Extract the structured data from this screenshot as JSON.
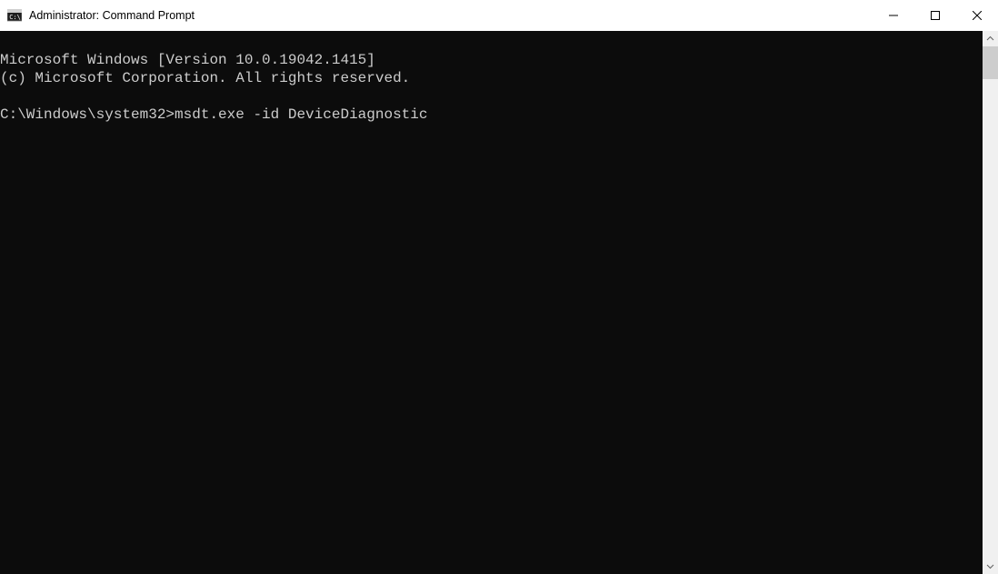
{
  "window": {
    "title": "Administrator: Command Prompt"
  },
  "terminal": {
    "line1": "Microsoft Windows [Version 10.0.19042.1415]",
    "line2": "(c) Microsoft Corporation. All rights reserved.",
    "blank": "",
    "prompt": "C:\\Windows\\system32>",
    "command": "msdt.exe -id DeviceDiagnostic"
  }
}
